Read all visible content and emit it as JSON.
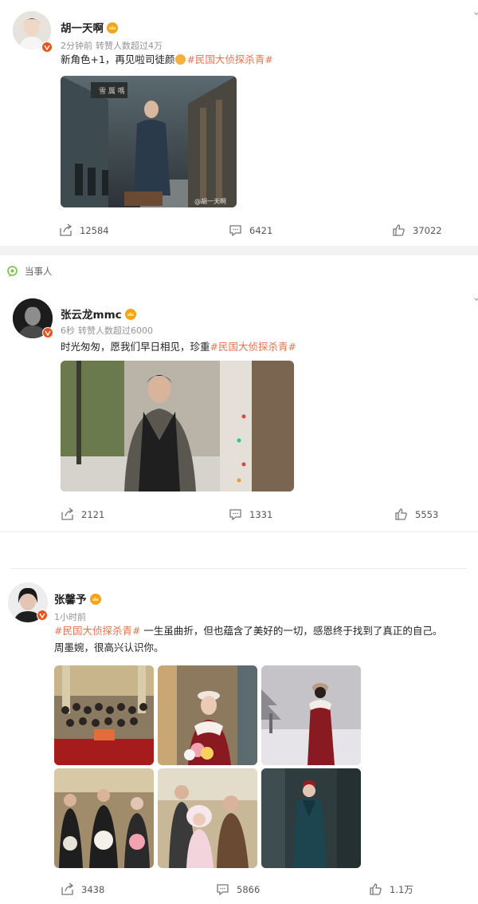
{
  "posts": [
    {
      "user": "胡一天啊",
      "time": "2分钟前",
      "reposts_note": "转赞人数超过4万",
      "text_before": "新角色+1，再见啦司徒颜",
      "tag": "#民国大侦探杀青#",
      "watermark": "@胡一天啊",
      "sign_text": "雪 厲 嗎",
      "shares": "12584",
      "comments": "6421",
      "likes": "37022"
    },
    {
      "label": "当事人",
      "user": "张云龙mmc",
      "time": "6秒",
      "reposts_note": "转赞人数超过6000",
      "text_before": "时光匆匆，愿我们早日相见，珍重",
      "tag": "#民国大侦探杀青#",
      "shares": "2121",
      "comments": "1331",
      "likes": "5553"
    },
    {
      "user": "张馨予",
      "time": "1小时前",
      "tag": "#民国大侦探杀青#",
      "text_after": " 一生虽曲折，但也蕴含了美好的一切，感恩终于找到了真正的自己。",
      "text_line2": "周墨婉，很高兴认识你。",
      "shares": "3438",
      "comments": "5866",
      "likes": "1.1万"
    }
  ],
  "colors": {
    "accent": "#eb7350",
    "verified": "#e8541e",
    "divider": "#f2f2f2"
  },
  "icons": [
    "share-icon",
    "comment-icon",
    "like-icon",
    "verified-icon",
    "crown-icon",
    "party-label-icon"
  ]
}
